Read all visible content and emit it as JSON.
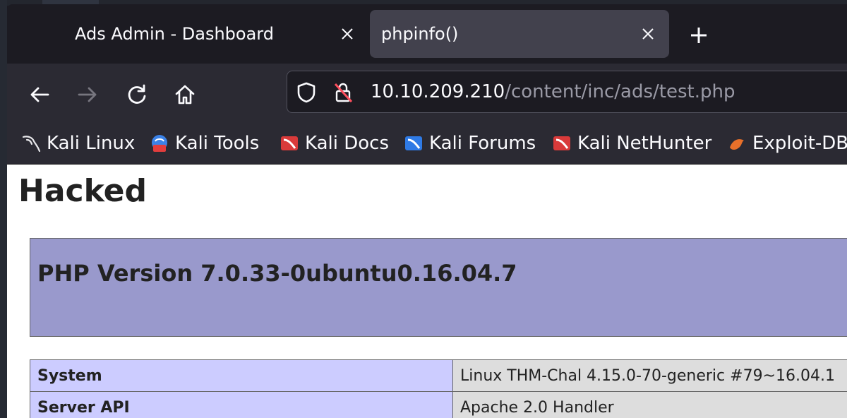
{
  "tabs": [
    {
      "title": "Ads Admin - Dashboard",
      "active": false
    },
    {
      "title": "phpinfo()",
      "active": true
    }
  ],
  "url": {
    "host": "10.10.209.210",
    "path": "/content/inc/ads/test.php"
  },
  "bookmarks": [
    {
      "label": "Kali Linux",
      "icon": "kali-dragon-icon"
    },
    {
      "label": "Kali Tools",
      "icon": "kali-tools-icon"
    },
    {
      "label": "Kali Docs",
      "icon": "kali-docs-icon"
    },
    {
      "label": "Kali Forums",
      "icon": "kali-forums-icon"
    },
    {
      "label": "Kali NetHunter",
      "icon": "kali-nethunter-icon"
    },
    {
      "label": "Exploit-DB",
      "icon": "exploit-db-icon"
    }
  ],
  "page": {
    "heading": "Hacked",
    "php_version": "PHP Version 7.0.33-0ubuntu0.16.04.7",
    "rows": [
      {
        "key": "System",
        "value": "Linux THM-Chal 4.15.0-70-generic #79~16.04.1"
      },
      {
        "key": "Server API",
        "value": "Apache 2.0 Handler"
      }
    ]
  },
  "colors": {
    "php_header": "#9999cc",
    "php_key_cell": "#ccccff",
    "php_value_cell": "#dddddd",
    "browser_chrome": "#2b2a33"
  }
}
